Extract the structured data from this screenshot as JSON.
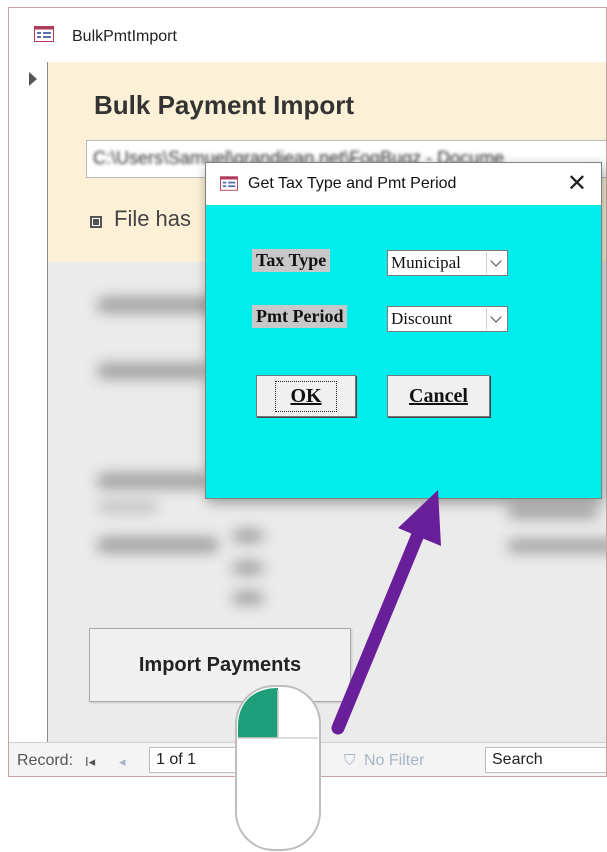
{
  "window": {
    "title": "BulkPmtImport",
    "icon": "form-icon"
  },
  "form": {
    "heading": "Bulk Payment Import",
    "file_path": "C:\\Users\\Samuel\\grandjean.net\\FogBugz - Docume",
    "checkbox_label": "File has",
    "checkbox_checked": true,
    "import_button_label": "Import Payments"
  },
  "dialog": {
    "title": "Get Tax Type and Pmt Period",
    "close_glyph": "✕",
    "tax_type_label": "Tax Type",
    "tax_type_value": "Municipal",
    "pmt_period_label": "Pmt Period",
    "pmt_period_value": "Discount",
    "ok_label": "OK",
    "cancel_label": "Cancel",
    "background_color": "#00eded"
  },
  "navbar": {
    "record_label": "Record:",
    "first_glyph": "I◂",
    "prev_glyph": "◂",
    "position": "1 of 1",
    "filter_label": "No Filter",
    "search_label": "Search"
  },
  "annotation": {
    "arrow_color": "#6a1f9a",
    "mouse_accent_color": "#1f9e7a"
  }
}
